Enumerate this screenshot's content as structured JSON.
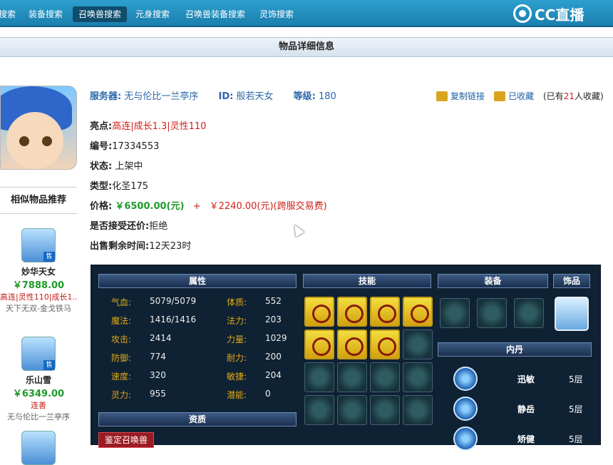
{
  "nav": {
    "tabs": [
      "搜索",
      "装备搜索",
      "召唤兽搜索",
      "元身搜索",
      "召唤兽装备搜索",
      "灵饰搜索"
    ],
    "active": 2
  },
  "logo": {
    "text": "CC直播"
  },
  "title": "物品详细信息",
  "summary": {
    "server_label": "服务器:",
    "server_value": "无与伦比一兰亭序",
    "id_label": "ID:",
    "id_value": "般若天女",
    "level_label": "等级:",
    "level_value": "180"
  },
  "actions": {
    "copy": "复制链接",
    "fav": "已收藏",
    "fav_count_pre": "(已有",
    "fav_count": "21",
    "fav_count_post": "人收藏)"
  },
  "details": {
    "highlight_label": "亮点:",
    "highlight_value": "高连|成长1.3|灵性110",
    "number_label": "编号:",
    "number_value": "17334553",
    "status_label": "状态:",
    "status_value": "上架中",
    "type_label": "类型:",
    "type_value": "化圣175",
    "price_label": "价格:",
    "price_value": "￥6500.00(元)",
    "price_plus": "+",
    "price_fee": "￥2240.00(元)(跨服交易费)",
    "bargain_label": "是否接受还价:",
    "bargain_value": "拒绝",
    "remain_label": "出售剩余时间:",
    "remain_value": "12天23时"
  },
  "similar": {
    "title": "相似物品推荐",
    "items": [
      {
        "name": "妙华天女",
        "price": "￥7888.00",
        "highlight": "高连|灵性110|成长1...",
        "server": "天下无双-金戈铁马"
      },
      {
        "name": "乐山雪",
        "price": "￥6349.00",
        "highlight": "连善",
        "server": "无与伦比一兰亭序"
      }
    ],
    "badge": "售"
  },
  "panel": {
    "attr_title": "属性",
    "skill_title": "技能",
    "equip_title": "装备",
    "ornament_title": "饰品",
    "neidan_title": "内丹",
    "aptitude_title": "资质",
    "button": "鉴定召唤兽",
    "attrs_left": [
      {
        "k": "气血:",
        "v": "5079/5079"
      },
      {
        "k": "魔法:",
        "v": "1416/1416"
      },
      {
        "k": "攻击:",
        "v": "2414"
      },
      {
        "k": "防御:",
        "v": "774"
      },
      {
        "k": "速度:",
        "v": "320"
      },
      {
        "k": "灵力:",
        "v": "955"
      }
    ],
    "attrs_right": [
      {
        "k": "体质:",
        "v": "552"
      },
      {
        "k": "法力:",
        "v": "203"
      },
      {
        "k": "力量:",
        "v": "1029"
      },
      {
        "k": "耐力:",
        "v": "200"
      },
      {
        "k": "敏捷:",
        "v": "204"
      },
      {
        "k": "潜能:",
        "v": "0"
      }
    ],
    "neidan": [
      {
        "name": "迅敏",
        "level": "5层"
      },
      {
        "name": "静岳",
        "level": "5层"
      },
      {
        "name": "矫健",
        "level": "5层"
      }
    ]
  }
}
